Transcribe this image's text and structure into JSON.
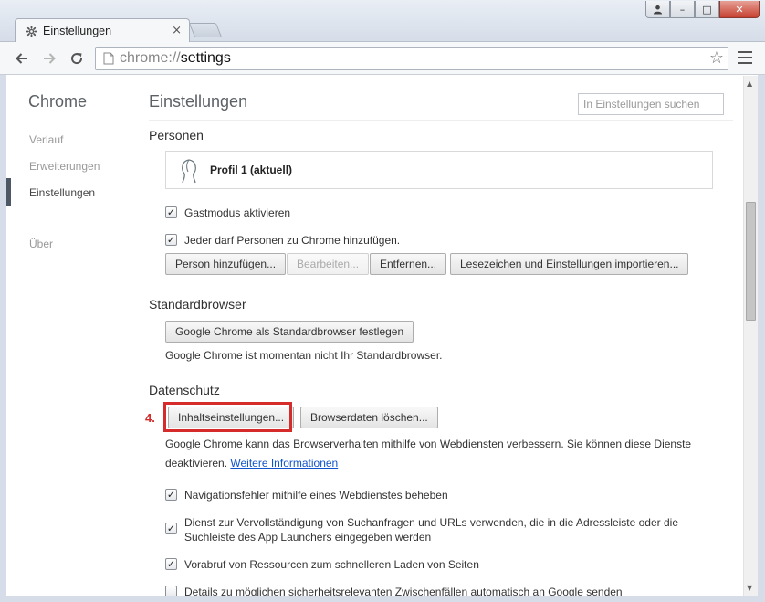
{
  "window": {
    "tab_title": "Einstellungen",
    "tab_close": "×",
    "minimize": "–",
    "maximize": "□",
    "close": "✕",
    "user": "👤"
  },
  "toolbar": {
    "url_scheme": "chrome://",
    "url_host": "settings",
    "star": "☆"
  },
  "sidebar": {
    "brand": "Chrome",
    "items": [
      {
        "label": "Verlauf"
      },
      {
        "label": "Erweiterungen"
      },
      {
        "label": "Einstellungen"
      },
      {
        "label": "Über"
      }
    ]
  },
  "main": {
    "title": "Einstellungen",
    "search_placeholder": "In Einstellungen suchen",
    "personen": {
      "title": "Personen",
      "profile_name": "Profil 1 (aktuell)",
      "checkboxes": [
        {
          "label": "Gastmodus aktivieren",
          "checked": true
        },
        {
          "label": "Jeder darf Personen zu Chrome hinzufügen.",
          "checked": true
        }
      ],
      "buttons": [
        {
          "label": "Person hinzufügen...",
          "disabled": false
        },
        {
          "label": "Bearbeiten...",
          "disabled": true
        },
        {
          "label": "Entfernen...",
          "disabled": false
        },
        {
          "label": "Lesezeichen und Einstellungen importieren...",
          "disabled": false
        }
      ]
    },
    "standardbrowser": {
      "title": "Standardbrowser",
      "button": "Google Chrome als Standardbrowser festlegen",
      "status": "Google Chrome ist momentan nicht Ihr Standardbrowser."
    },
    "datenschutz": {
      "title": "Datenschutz",
      "step_label": "4.",
      "content_settings_button": "Inhaltseinstellungen...",
      "clear_data_button": "Browserdaten löschen...",
      "description": "Google Chrome kann das Browserverhalten mithilfe von Webdiensten verbessern. Sie können diese Dienste deaktivieren.",
      "more_info_link": "Weitere Informationen",
      "checkboxes": [
        {
          "label": "Navigationsfehler mithilfe eines Webdienstes beheben",
          "checked": true
        },
        {
          "label": "Dienst zur Vervollständigung von Suchanfragen und URLs verwenden, die in die Adressleiste oder die Suchleiste des App Launchers eingegeben werden",
          "checked": true
        },
        {
          "label": "Vorabruf von Ressourcen zum schnelleren Laden von Seiten",
          "checked": true
        },
        {
          "label": "Details zu möglichen sicherheitsrelevanten Zwischenfällen automatisch an Google senden",
          "checked": false
        }
      ]
    }
  },
  "colors": {
    "accent_red": "#d52b2b",
    "link": "#1155cc"
  }
}
